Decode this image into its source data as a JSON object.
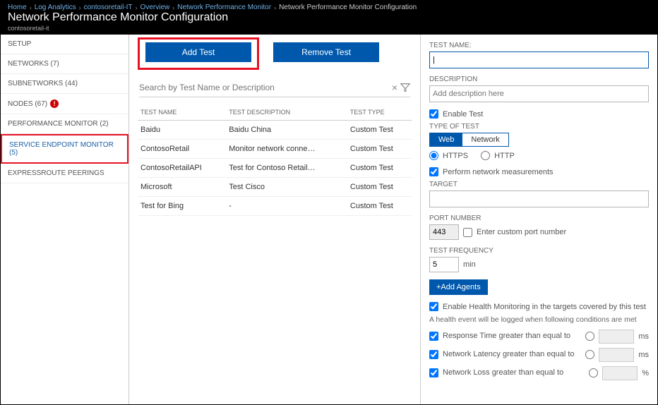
{
  "breadcrumb": [
    {
      "label": "Home",
      "last": false
    },
    {
      "label": "Log Analytics",
      "last": false
    },
    {
      "label": "contosoretail-IT",
      "last": false
    },
    {
      "label": "Overview",
      "last": false
    },
    {
      "label": "Network Performance Monitor",
      "last": false
    },
    {
      "label": "Network Performance Monitor Configuration",
      "last": true
    }
  ],
  "header": {
    "title": "Network Performance Monitor Configuration",
    "subtitle": "contosoretail-it"
  },
  "sidebar": {
    "items": [
      {
        "label": "SETUP",
        "alert": false
      },
      {
        "label": "NETWORKS (7)",
        "alert": false
      },
      {
        "label": "SUBNETWORKS (44)",
        "alert": false
      },
      {
        "label": "NODES (67)",
        "alert": true,
        "alert_text": "!"
      },
      {
        "label": "PERFORMANCE MONITOR (2)",
        "alert": false
      },
      {
        "label": "SERVICE ENDPOINT MONITOR (5)",
        "alert": false,
        "selected": true
      },
      {
        "label": "EXPRESSROUTE PEERINGS",
        "alert": false
      }
    ]
  },
  "center": {
    "add_test": "Add Test",
    "remove_test": "Remove Test",
    "search_placeholder": "Search by Test Name or Description",
    "columns": [
      "TEST NAME",
      "TEST DESCRIPTION",
      "TEST TYPE"
    ],
    "rows": [
      {
        "name": "Baidu",
        "desc": "Baidu China",
        "type": "Custom Test"
      },
      {
        "name": "ContosoRetail",
        "desc": "Monitor network conne…",
        "type": "Custom Test"
      },
      {
        "name": "ContosoRetailAPI",
        "desc": "Test for Contoso Retail…",
        "type": "Custom Test"
      },
      {
        "name": "Microsoft",
        "desc": "Test Cisco",
        "type": "Custom Test"
      },
      {
        "name": "Test for Bing",
        "desc": "-",
        "type": "Custom Test"
      }
    ]
  },
  "right": {
    "test_name_label": "TEST NAME:",
    "test_name_value": "",
    "desc_label": "DESCRIPTION",
    "desc_placeholder": "Add description here",
    "enable_test": "Enable Test",
    "type_of_test": "TYPE OF TEST",
    "web": "Web",
    "network": "Network",
    "https": "HTTPS",
    "http": "HTTP",
    "perform_measurements": "Perform network measurements",
    "target_label": "TARGET",
    "port_label": "PORT NUMBER",
    "port_value": "443",
    "custom_port": "Enter custom port number",
    "freq_label": "TEST FREQUENCY",
    "freq_value": "5",
    "freq_unit": "min",
    "add_agents": "+Add Agents",
    "enable_health": "Enable Health Monitoring in the targets covered by this test",
    "health_note": "A health event will be logged when following conditions are met",
    "thresholds": [
      {
        "label": "Response Time greater than equal to",
        "unit": "ms"
      },
      {
        "label": "Network Latency greater than equal to",
        "unit": "ms"
      },
      {
        "label": "Network Loss greater than equal to",
        "unit": "%"
      }
    ]
  }
}
